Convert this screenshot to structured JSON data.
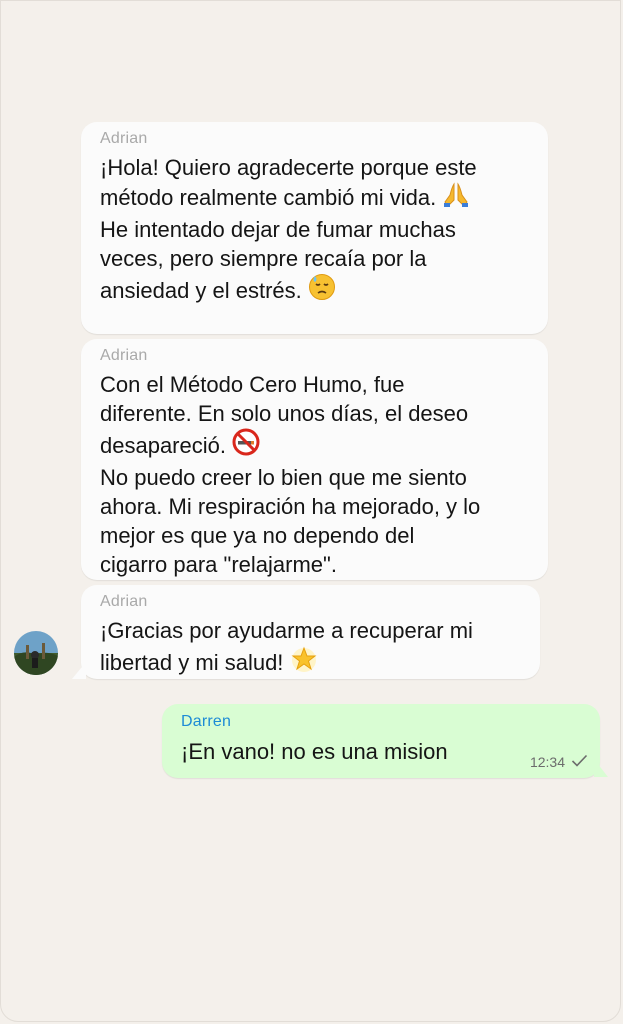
{
  "messages": [
    {
      "sender": "Adrian",
      "lines": [
        "¡Hola! Quiero agradecerte porque este",
        "método realmente cambió mi vida.",
        "He intentado dejar de fumar muchas",
        "veces, pero siempre recaía por la",
        "ansiedad y el estrés."
      ],
      "emojis": [
        "praying-hands-emoji",
        "downcast-sweat-face-emoji"
      ]
    },
    {
      "sender": "Adrian",
      "lines": [
        "Con el Método Cero Humo, fue",
        "diferente. En solo unos días, el deseo",
        "desapareció.",
        "No puedo creer lo bien que me siento",
        "ahora. Mi respiración ha mejorado, y lo",
        "mejor es que ya no dependo del",
        "cigarro para \"relajarme\"."
      ],
      "emojis": [
        "no-smoking-emoji"
      ]
    },
    {
      "sender": "Adrian",
      "lines": [
        "¡Gracias por ayudarme a recuperar mi",
        "libertad y mi salud!"
      ],
      "emojis": [
        "glowing-star-emoji"
      ]
    },
    {
      "sender": "Darren",
      "lines": [
        "¡En vano! no es una mision"
      ],
      "time": "12:34",
      "status_icon": "single-check-icon"
    }
  ],
  "colors": {
    "background": "#f4f0eb",
    "incoming_bubble": "#fbfbfb",
    "outgoing_bubble": "#d9fdd3",
    "incoming_sender": "#a9a9a9",
    "outgoing_sender": "#1d8bd6"
  }
}
